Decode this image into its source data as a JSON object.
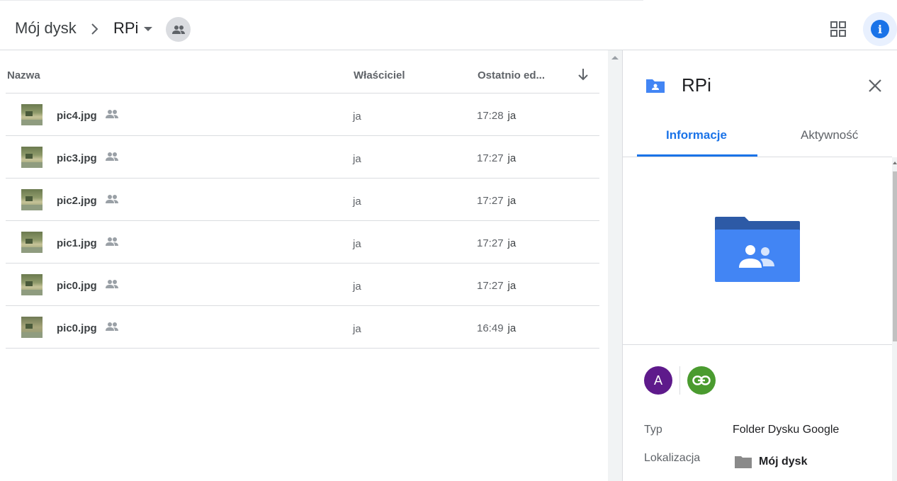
{
  "header": {
    "breadcrumb_root": "Mój dysk",
    "breadcrumb_current": "RPi"
  },
  "list": {
    "columns": {
      "name": "Nazwa",
      "owner": "Właściciel",
      "modified": "Ostatnio ed..."
    },
    "rows": [
      {
        "name": "pic4.jpg",
        "owner": "ja",
        "time": "17:28",
        "by": "ja"
      },
      {
        "name": "pic3.jpg",
        "owner": "ja",
        "time": "17:27",
        "by": "ja"
      },
      {
        "name": "pic2.jpg",
        "owner": "ja",
        "time": "17:27",
        "by": "ja"
      },
      {
        "name": "pic1.jpg",
        "owner": "ja",
        "time": "17:27",
        "by": "ja"
      },
      {
        "name": "pic0.jpg",
        "owner": "ja",
        "time": "17:27",
        "by": "ja"
      },
      {
        "name": "pic0.jpg",
        "owner": "ja",
        "time": "16:49",
        "by": "ja"
      }
    ]
  },
  "panel": {
    "title": "RPi",
    "tabs": {
      "info": "Informacje",
      "activity": "Aktywność"
    },
    "avatar_letter": "A",
    "props": {
      "type_label": "Typ",
      "type_value": "Folder Dysku Google",
      "location_label": "Lokalizacja",
      "location_value": "Mój dysk"
    }
  },
  "colors": {
    "accent": "#1a73e8",
    "folder_blue": "#4285f4",
    "avatar": "#5e1a8b",
    "link_green": "#4a9b2f"
  },
  "icons": [
    "chevron-right-icon",
    "caret-down-icon",
    "shared-people-icon",
    "grid-view-icon",
    "info-icon",
    "sort-down-arrow-icon",
    "shared-folder-icon",
    "close-icon",
    "link-icon",
    "folder-icon"
  ]
}
